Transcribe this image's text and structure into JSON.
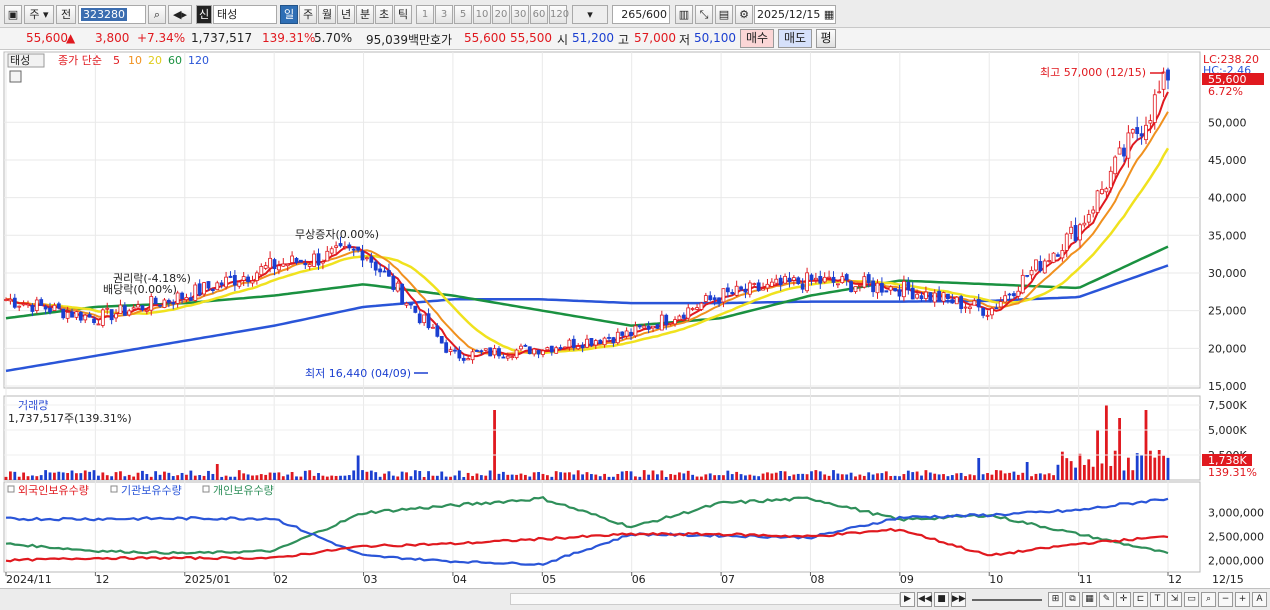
{
  "toolbar": {
    "market_tab": "주",
    "prev_label": "전",
    "stock_code": "323280",
    "credit_label": "신",
    "stock_name": "태성",
    "periods": [
      "일",
      "주",
      "월",
      "년",
      "분",
      "초",
      "틱"
    ],
    "active_period": "일",
    "intervals": [
      "1",
      "3",
      "5",
      "10",
      "20",
      "30",
      "60",
      "120"
    ],
    "count_value": "265",
    "count_total": "/600",
    "date": "2025/12/15"
  },
  "quote": {
    "price": "55,600",
    "arrow": "▲",
    "change": "3,800",
    "change_pct": "+7.34%",
    "volume": "1,737,517",
    "volume_ratio": "139.31%",
    "turnover": "5.70%",
    "amount": "95,039백만",
    "hoga_label": "호가",
    "ask": "55,600",
    "bid": "55,500",
    "open_label": "시",
    "open": "51,200",
    "high_label": "고",
    "high": "57,000",
    "low_label": "저",
    "low": "50,100",
    "buy_label": "매수",
    "sell_label": "매도",
    "eval_label": "평"
  },
  "price_panel": {
    "name_tag": "태성",
    "legend_prefix": "종가 단순",
    "ma_labels": [
      "5",
      "10",
      "20",
      "60",
      "120"
    ],
    "ma_colors": [
      "#e0191f",
      "#f0901e",
      "#f0e21e",
      "#1a9140",
      "#2a55d8"
    ],
    "lc_label": "LC:238.20",
    "hc_label": "HC:-2.46",
    "price_tag": "55,600",
    "pct_tag": "6.72%",
    "y_ticks": [
      "50,000",
      "45,000",
      "40,000",
      "35,000",
      "30,000",
      "25,000",
      "20,000",
      "15,000"
    ],
    "high_annotation": "최고 57,000 (12/15)",
    "low_annotation": "최저 16,440 (04/09)",
    "event1": "권리락(-4.18%)",
    "event2": "배당락(0.00%)",
    "event3": "무상증자(0.00%)"
  },
  "volume_panel": {
    "title": "거래량",
    "value": "1,737,517주(139.31%)",
    "y_ticks": [
      "7,500K",
      "5,000K",
      "2,500K"
    ],
    "tag": "1,738K",
    "tag2": "139.31%"
  },
  "holdings_panel": {
    "legend": [
      "외국인보유수량",
      "기관보유수량",
      "개인보유수량"
    ],
    "colors": [
      "#e0191f",
      "#2a55d8",
      "#2f8f5a"
    ],
    "y_ticks": [
      "3,000,000",
      "2,500,000",
      "2,000,000"
    ]
  },
  "x_axis": {
    "labels": [
      "2024/11",
      "12",
      "2025/01",
      "02",
      "03",
      "04",
      "05",
      "06",
      "07",
      "08",
      "09",
      "10",
      "11",
      "12"
    ],
    "right_label": "12/15"
  },
  "chart_data": {
    "type": "line",
    "title": "",
    "series_note": "daily candles with moving averages",
    "months": [
      "2024/11",
      "12",
      "2025/01",
      "02",
      "03",
      "04",
      "05",
      "06",
      "07",
      "08",
      "09",
      "10",
      "11",
      "12"
    ],
    "close_by_month": [
      26500,
      24000,
      27000,
      31000,
      33000,
      19000,
      20000,
      22000,
      27000,
      29000,
      28000,
      25000,
      36000,
      55600
    ],
    "ma120_by_month": [
      17000,
      19000,
      21000,
      23000,
      25500,
      26500,
      26500,
      26000,
      26000,
      26200,
      26200,
      26300,
      26800,
      31000
    ],
    "ma60_by_month": [
      24000,
      25500,
      26000,
      27000,
      28500,
      27000,
      25000,
      23000,
      24000,
      27000,
      29000,
      28500,
      28000,
      33500
    ],
    "ylim": [
      15000,
      60000
    ],
    "high": {
      "value": 57000,
      "date": "12/15"
    },
    "low": {
      "value": 16440,
      "date": "04/09"
    }
  }
}
